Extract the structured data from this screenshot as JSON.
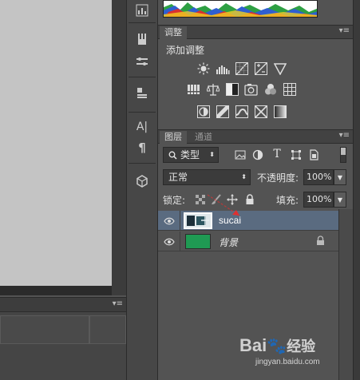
{
  "adjustments_panel": {
    "tab_label": "调整",
    "menu_glyph": "▾≡",
    "title": "添加调整",
    "row1_icons": [
      "brightness-contrast-icon",
      "levels-icon",
      "curves-icon",
      "exposure-icon",
      "vibrance-icon"
    ],
    "row2_icons": [
      "hue-saturation-icon",
      "color-balance-icon",
      "black-white-icon",
      "photo-filter-icon",
      "channel-mixer-icon",
      "color-lookup-icon"
    ],
    "row3_icons": [
      "invert-icon",
      "posterize-icon",
      "threshold-icon",
      "selective-color-icon",
      "gradient-map-icon"
    ]
  },
  "layers_panel": {
    "tabs": [
      {
        "label": "图层",
        "active": true
      },
      {
        "label": "通道",
        "active": false
      }
    ],
    "menu_glyph": "▾≡",
    "filter": {
      "label": "类型",
      "icon": "search-icon"
    },
    "blend_mode": "正常",
    "opacity_label": "不透明度:",
    "opacity_value": "100%",
    "lock_label": "锁定:",
    "fill_label": "填充:",
    "fill_value": "100%",
    "layers": [
      {
        "name": "sucai",
        "selected": true,
        "thumb_color": "#3a6f7a"
      },
      {
        "name": "背景",
        "selected": false,
        "thumb_color": "#1f9a53",
        "locked": true
      }
    ]
  },
  "bottom_panel": {
    "menu_glyph": "▾≡"
  },
  "watermark": {
    "brand": "Bai",
    "paw": "🐾",
    "suffix": "经验",
    "url": "jingyan.baidu.com"
  },
  "colors": {
    "selected_row": "#5a6b80",
    "panel_bg": "#535353",
    "canvas_bg": "#c4c4c4"
  }
}
